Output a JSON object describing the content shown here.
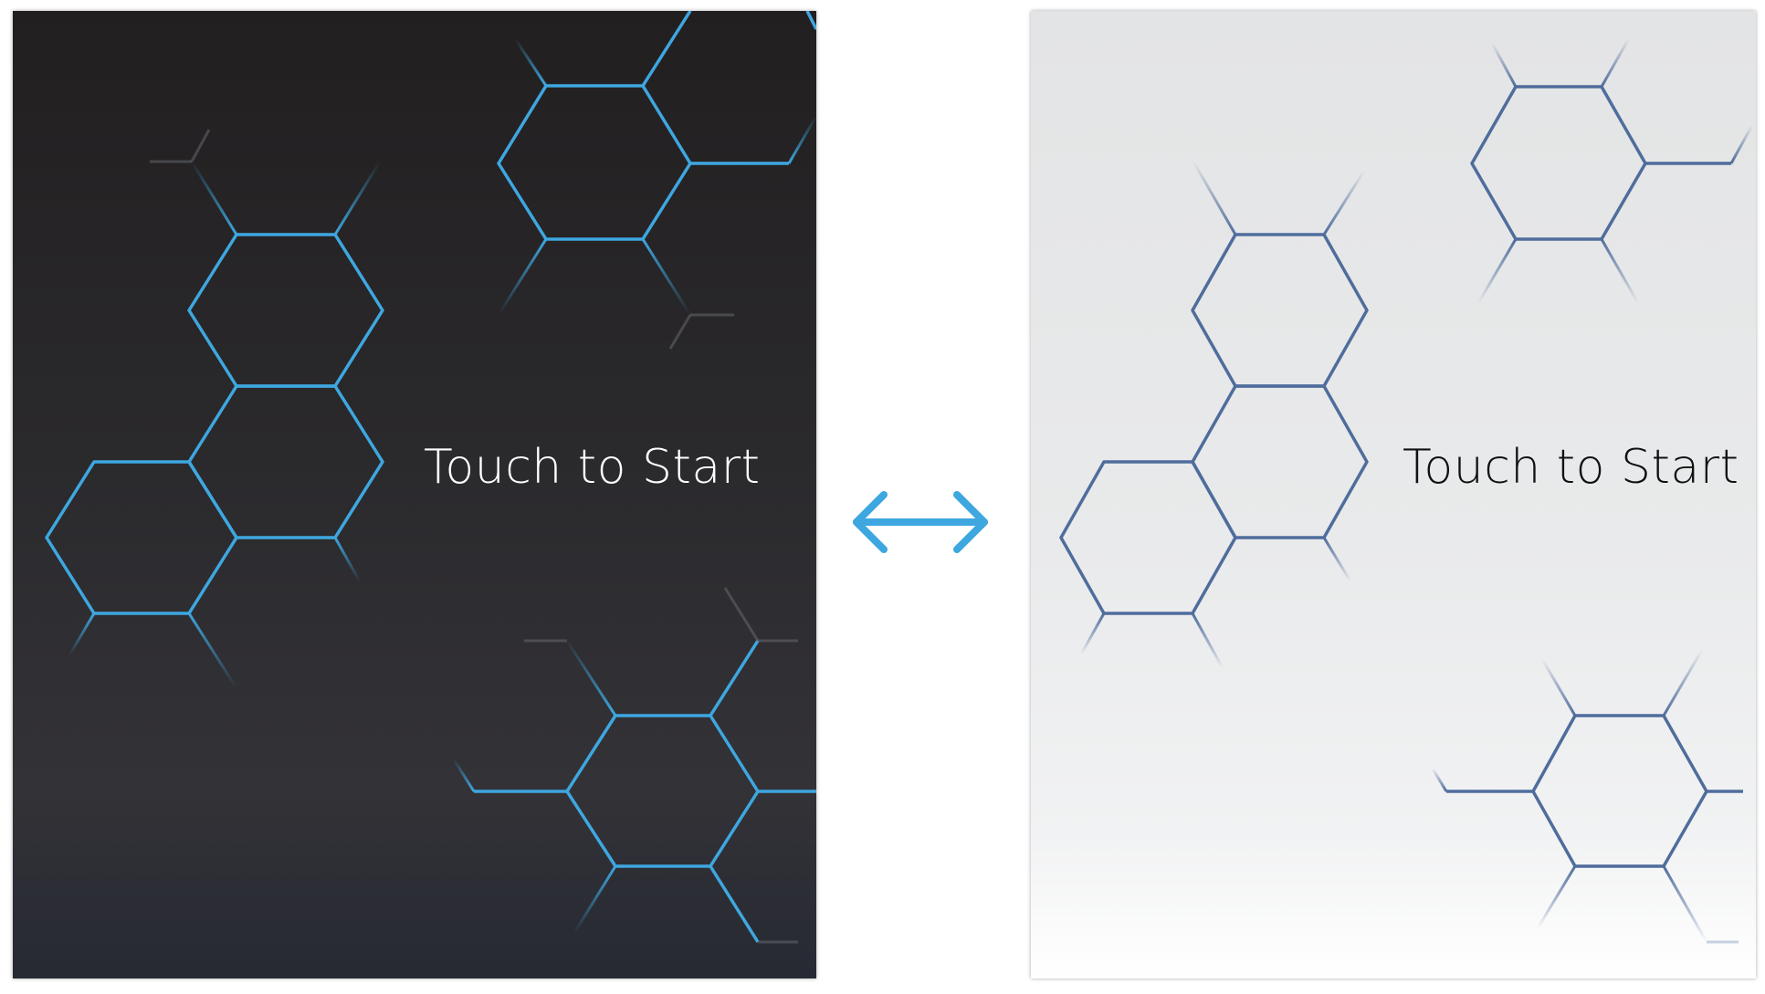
{
  "dark_screen": {
    "label": "Touch to Start",
    "background": "#221f20",
    "hex_color": "#3ea7e0",
    "text_color": "#ffffff",
    "icon": "hexagon-pattern-icon"
  },
  "light_screen": {
    "label": "Touch to Start",
    "background": "#e4e5e6",
    "hex_color": "#4f6d9c",
    "text_color": "#111111",
    "icon": "hexagon-pattern-icon"
  },
  "swap": {
    "icon": "double-arrow-icon",
    "color": "#3ea7e0"
  }
}
